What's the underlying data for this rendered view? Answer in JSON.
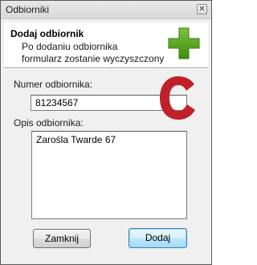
{
  "window": {
    "title": "Odbiorniki",
    "close_glyph": "✕"
  },
  "header": {
    "title": "Dodaj odbiornik",
    "line1": "Po dodaniu odbiornika",
    "line2": "formularz zostanie wyczyszczony",
    "icon": "green-plus-icon"
  },
  "form": {
    "number_label": "Numer odbiornika:",
    "number_value": "81234567",
    "description_label": "Opis odbiornika:",
    "description_value": "Zarośla Twarde 67",
    "clear_icon": "red-c-icon"
  },
  "buttons": {
    "close_label": "Zamknij",
    "add_label": "Dodaj"
  },
  "colors": {
    "plus_green": "#5aa71d",
    "c_red": "#c0202a"
  }
}
